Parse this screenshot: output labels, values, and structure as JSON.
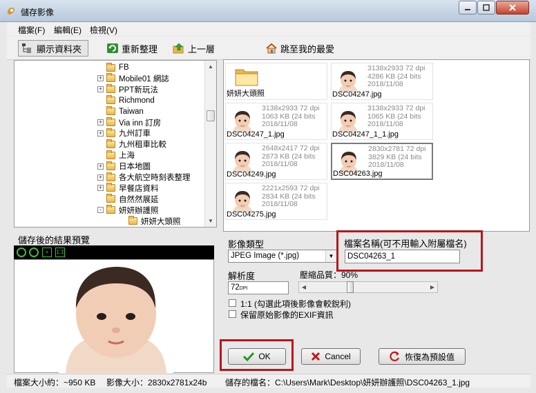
{
  "window": {
    "title": "儲存影像"
  },
  "menu": [
    {
      "label": "檔案(F)"
    },
    {
      "label": "編輯(E)"
    },
    {
      "label": "檢視(V)"
    }
  ],
  "toolbar": {
    "show_folders": "顯示資料夾",
    "refresh": "重新整理",
    "up": "上一層",
    "favorites": "跳至我的最愛"
  },
  "tree": [
    {
      "label": "FB",
      "expand": ""
    },
    {
      "label": "Mobile01 網誌",
      "expand": "+"
    },
    {
      "label": "PPT新玩法",
      "expand": "+"
    },
    {
      "label": "Richmond",
      "expand": ""
    },
    {
      "label": "Taiwan",
      "expand": ""
    },
    {
      "label": "Via inn 訂房",
      "expand": "+"
    },
    {
      "label": "九州訂車",
      "expand": "+"
    },
    {
      "label": "九州租車比較",
      "expand": ""
    },
    {
      "label": "上海",
      "expand": ""
    },
    {
      "label": "日本地圖",
      "expand": "+"
    },
    {
      "label": "各大航空時刻表整理",
      "expand": "+"
    },
    {
      "label": "早餐店資料",
      "expand": "+"
    },
    {
      "label": "自然然展延",
      "expand": ""
    },
    {
      "label": "妍妍辦護照",
      "expand": "-"
    },
    {
      "label": "妍妍大頭照",
      "expand": ""
    }
  ],
  "preview": {
    "label": "儲存後的結果預覽"
  },
  "thumbs": [
    {
      "name": "妍妍大頭照",
      "is_folder": true,
      "dims": "",
      "size": "",
      "date": ""
    },
    {
      "name": "DSC04247.jpg",
      "dims": "3138x2933 72 dpi",
      "size": "4286 KB (24 bits",
      "date": "2018/11/08"
    },
    {
      "name": "DSC04247_1.jpg",
      "dims": "3138x2933 72 dpi",
      "size": "1063 KB (24 bits",
      "date": "2018/11/08"
    },
    {
      "name": "DSC04247_1_1.jpg",
      "dims": "3138x2933 72 dpi",
      "size": "1065 KB (24 bits",
      "date": "2018/11/08"
    },
    {
      "name": "DSC04249.jpg",
      "dims": "2648x2417 72 dpi",
      "size": "2873 KB (24 bits",
      "date": "2018/11/08"
    },
    {
      "name": "DSC04263.jpg",
      "dims": "2830x2781 72 dpi",
      "size": "3829 KB (24 bits",
      "date": "2018/11/08",
      "selected": true
    },
    {
      "name": "DSC04275.jpg",
      "dims": "2221x2593 72 dpi",
      "size": "2834 KB (24 bits",
      "date": "2018/11/08"
    }
  ],
  "options": {
    "image_type_label": "影像類型",
    "image_type_value": "JPEG Image (*.jpg)",
    "filename_label": "檔案名稱(可不用輸入附屬檔名)",
    "filename_value": "DSC04263_1",
    "resolution_label": "解析度",
    "resolution_value": "72",
    "resolution_unit": "DPI",
    "quality_label": "壓縮品質：90%",
    "quality": 90,
    "checkbox_sharpen": "1:1 (勾選此項後影像會較銳利)",
    "checkbox_exif": "保留原始影像的EXIF資訊"
  },
  "buttons": {
    "ok": "OK",
    "cancel": "Cancel",
    "reset": "恢復為預設值"
  },
  "status": {
    "file_size": "檔案大小約：~950 KB",
    "image_size": "影像大小：2830x2781x24b",
    "save_path": "儲存的檔名：C:\\Users\\Mark\\Desktop\\妍妍辦護照\\DSC04263_1.jpg"
  },
  "colors": {
    "highlight_border": "#b8161b",
    "ok_check": "#1f9a1f",
    "cancel_x": "#c21818"
  }
}
